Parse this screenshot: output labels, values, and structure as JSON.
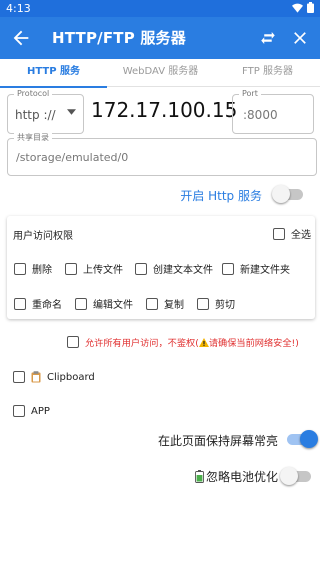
{
  "status_bar": {
    "time": "4:13",
    "icons": [
      "wifi-icon",
      "battery-icon"
    ]
  },
  "app_bar": {
    "title": "HTTP/FTP 服务器",
    "icons": [
      "back-arrow-icon",
      "swap-icon",
      "close-icon"
    ]
  },
  "tabs": [
    {
      "label": "HTTP 服务",
      "active": true
    },
    {
      "label": "WebDAV 服务器",
      "active": false
    },
    {
      "label": "FTP 服务器",
      "active": false
    }
  ],
  "server": {
    "protocol_label": "Protocol",
    "protocol_value": "http ://",
    "ip": "172.17.100.15",
    "port_label": "Port",
    "port_value": ":8000",
    "share_label": "共享目录",
    "share_value": "/storage/emulated/0"
  },
  "http_toggle": {
    "label": "开启 Http 服务",
    "on": false
  },
  "permissions": {
    "title": "用户访问权限",
    "select_all": "全选",
    "row1": [
      "删除",
      "上传文件",
      "创建文本文件",
      "新建文件夹"
    ],
    "row2": [
      "重命名",
      "编辑文件",
      "复制",
      "剪切"
    ]
  },
  "anonymous_warning": {
    "text_before": "允许所有用户访问，不鉴权(",
    "icon": "warning-icon",
    "text_after": "请确保当前网络安全!)"
  },
  "clipboard": {
    "label": "Clipboard",
    "icon": "clipboard-icon"
  },
  "app_option": {
    "label": "APP"
  },
  "keep_screen": {
    "label": "在此页面保持屏幕常亮",
    "on": true
  },
  "ignore_battery": {
    "label": "忽略电池优化",
    "icon": "battery-icon",
    "on": false
  },
  "colors": {
    "accent": "#2a7de1",
    "status_bar": "#1f6fdc",
    "warning": "#e03030"
  }
}
